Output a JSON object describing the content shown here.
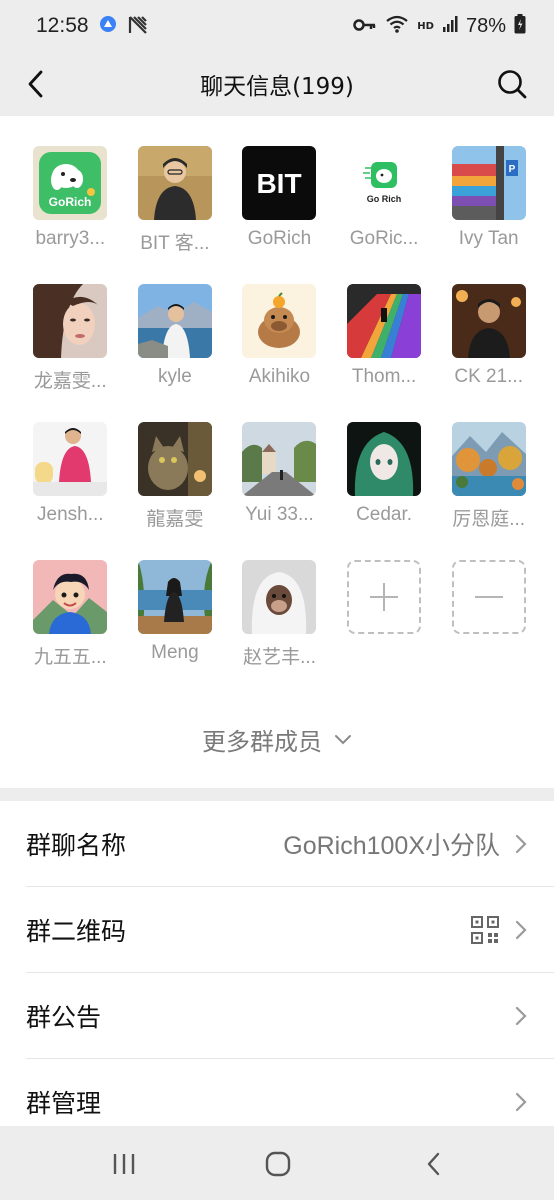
{
  "status": {
    "time": "12:58",
    "battery": "78%",
    "hd": "HD"
  },
  "header": {
    "title": "聊天信息(199)"
  },
  "members": [
    {
      "name": "barry3...",
      "avatar": "gorich-dog"
    },
    {
      "name": "BIT 客...",
      "avatar": "photo-cartoon-man"
    },
    {
      "name": "GoRich",
      "avatar": "bit-logo",
      "logo_text": "BIT"
    },
    {
      "name": "GoRic...",
      "avatar": "gorich-logo",
      "logo_text": "Go Rich"
    },
    {
      "name": "Ivy Tan",
      "avatar": "photo-colorful-building"
    },
    {
      "name": "龙嘉雯...",
      "avatar": "photo-woman"
    },
    {
      "name": "kyle",
      "avatar": "photo-man-lake"
    },
    {
      "name": "Akihiko",
      "avatar": "capybara"
    },
    {
      "name": "Thom...",
      "avatar": "photo-escalator"
    },
    {
      "name": "CK 21...",
      "avatar": "photo-man-restaurant"
    },
    {
      "name": "Jensh...",
      "avatar": "photo-man-desk"
    },
    {
      "name": "龍嘉雯",
      "avatar": "photo-cat"
    },
    {
      "name": "Yui 33...",
      "avatar": "photo-street"
    },
    {
      "name": "Cedar.",
      "avatar": "anime-green-hair"
    },
    {
      "name": "厉恩庭...",
      "avatar": "painting-landscape"
    },
    {
      "name": "九五五...",
      "avatar": "cartoon-boy"
    },
    {
      "name": "Meng",
      "avatar": "photo-woman-bench"
    },
    {
      "name": "赵艺丰...",
      "avatar": "monkey-hoodie"
    }
  ],
  "more_members_label": "更多群成员",
  "settings": {
    "group_name": {
      "label": "群聊名称",
      "value": "GoRich100X小分队"
    },
    "qr_code": {
      "label": "群二维码"
    },
    "announcement": {
      "label": "群公告"
    },
    "management": {
      "label": "群管理"
    }
  },
  "colors": {
    "background": "#ededed",
    "panel": "#ffffff",
    "muted_text": "#9a9a9a",
    "gorich_green": "#34b86a"
  }
}
